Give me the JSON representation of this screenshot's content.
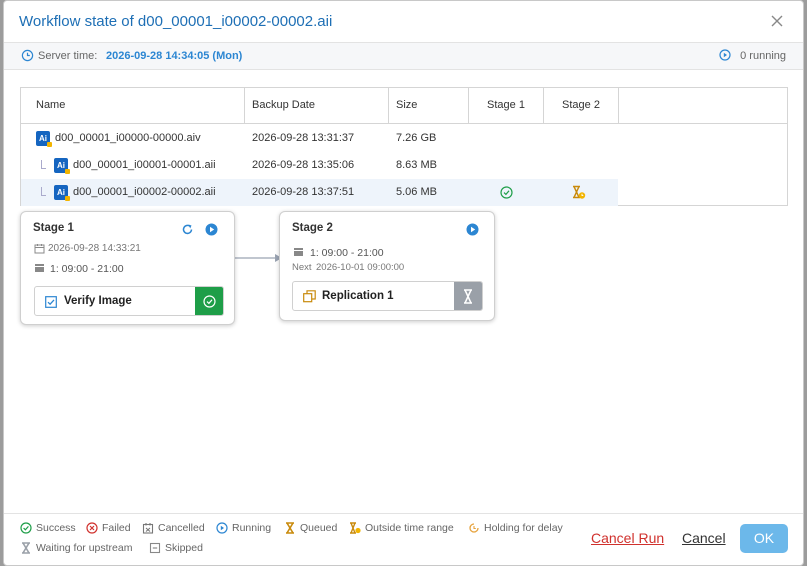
{
  "dialog": {
    "title": "Workflow state of d00_00001_i00002-00002.aii",
    "close_icon": "close-icon"
  },
  "info": {
    "server_time_label": "Server time:",
    "server_time_value": "2026-09-28 14:34:05 (Mon)",
    "running": "0 running"
  },
  "grid": {
    "columns": [
      "Name",
      "Backup Date",
      "Size",
      "Stage 1",
      "Stage 2"
    ],
    "rows": [
      {
        "name": "d00_00001_i00000-00000.aiv",
        "date": "2026-09-28 13:31:37",
        "size": "7.26 GB",
        "stage1": "",
        "stage2": ""
      },
      {
        "name": "d00_00001_i00001-00001.aii",
        "date": "2026-09-28 13:35:06",
        "size": "8.63 MB",
        "stage1": "",
        "stage2": ""
      },
      {
        "name": "d00_00001_i00002-00002.aii",
        "date": "2026-09-28 13:37:51",
        "size": "5.06 MB",
        "stage1": "success",
        "stage2": "outside-time-range"
      }
    ]
  },
  "stages": [
    {
      "name": "Stage 1",
      "last_run": "2026-09-28 14:33:21",
      "schedule": "1: 09:00 - 21:00",
      "task": "Verify Image",
      "task_status": "success"
    },
    {
      "name": "Stage 2",
      "schedule": "1: 09:00 - 21:00",
      "next_label": "Next",
      "next_value": "2026-10-01 09:00:00",
      "task": "Replication 1",
      "task_status": "waiting-for-upstream"
    }
  ],
  "legend": {
    "success": "Success",
    "failed": "Failed",
    "cancelled": "Cancelled",
    "running": "Running",
    "queued": "Queued",
    "outside": "Outside time range",
    "holding": "Holding for delay",
    "waiting": "Waiting for upstream",
    "skipped": "Skipped"
  },
  "buttons": {
    "cancel_run": "Cancel Run",
    "cancel": "Cancel",
    "ok": "OK"
  },
  "colors": {
    "title_blue": "#1e6fb5",
    "success_green": "#1e9e48",
    "danger_red": "#d0312d",
    "ok_button": "#6cb8ea",
    "outside_orange": "#c98a0c"
  }
}
